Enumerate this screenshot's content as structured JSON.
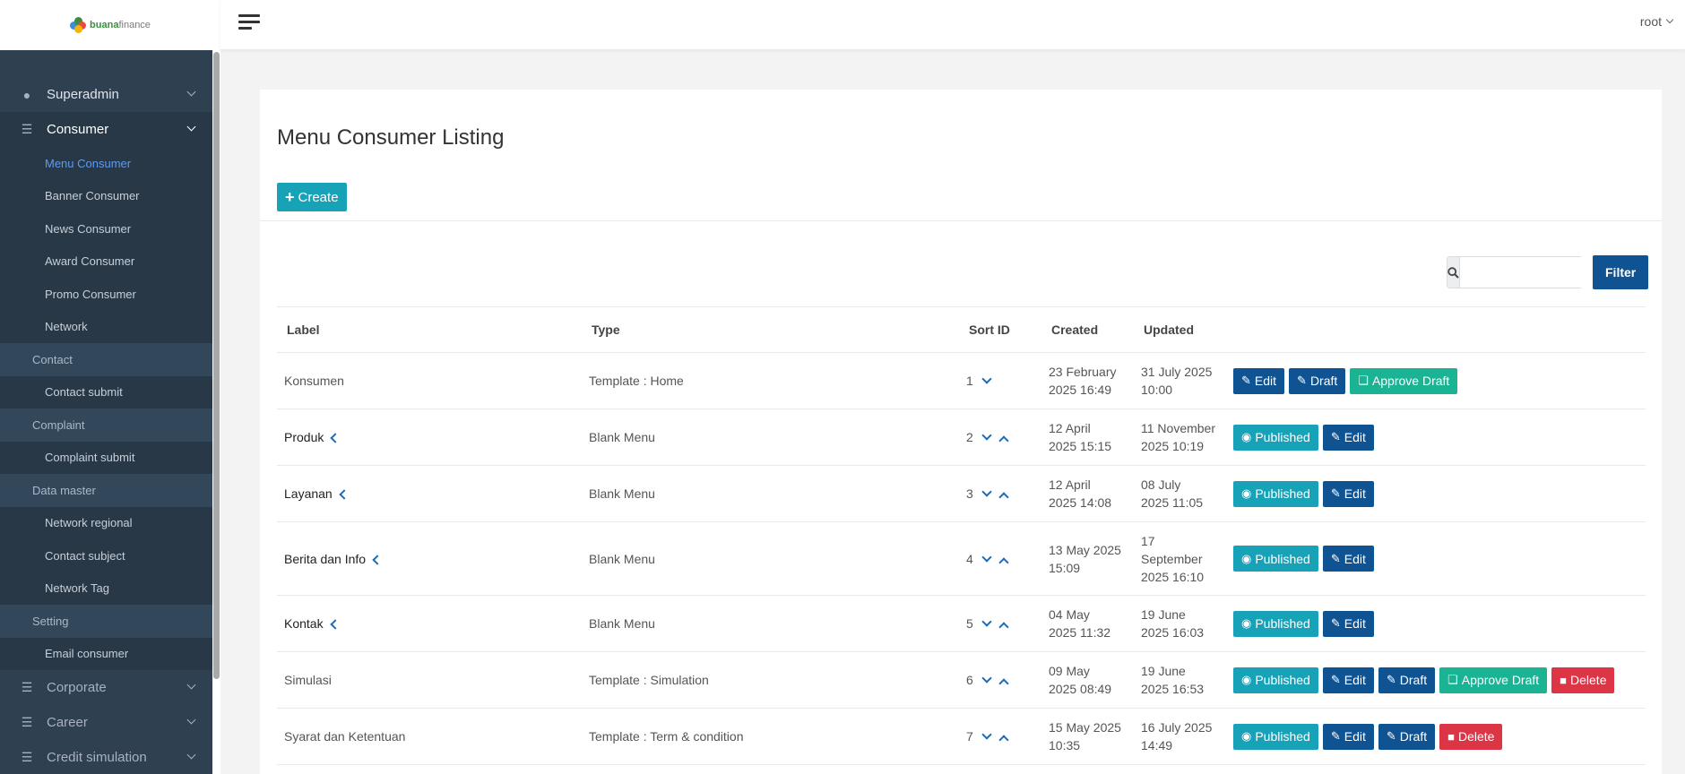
{
  "brand": {
    "part1": "buana",
    "part2": "finance",
    "colors": [
      "#3a8f3f",
      "#e84c3d",
      "#3d8bd9",
      "#f4b400"
    ]
  },
  "user": {
    "name": "root"
  },
  "sidebar": {
    "items": [
      {
        "label": "Superadmin",
        "icon": "user-icon"
      },
      {
        "label": "Consumer",
        "icon": "list-icon"
      }
    ],
    "consumer_sub": [
      "Menu Consumer",
      "Banner Consumer",
      "News Consumer",
      "Award Consumer",
      "Promo Consumer",
      "Network"
    ],
    "groups": [
      {
        "label": "Contact",
        "children": [
          "Contact submit"
        ]
      },
      {
        "label": "Complaint",
        "children": [
          "Complaint submit"
        ]
      },
      {
        "label": "Data master",
        "children": [
          "Network regional",
          "Contact subject",
          "Network Tag"
        ]
      },
      {
        "label": "Setting",
        "children": [
          "Email consumer"
        ]
      }
    ],
    "bottom_items": [
      {
        "label": "Corporate",
        "icon": "list-icon"
      },
      {
        "label": "Career",
        "icon": "list-icon"
      },
      {
        "label": "Credit simulation",
        "icon": "list-icon"
      }
    ]
  },
  "page": {
    "title": "Menu Consumer Listing",
    "create_label": "Create",
    "search_placeholder": "",
    "filter_label": "Filter"
  },
  "table": {
    "headers": [
      "Label",
      "Type",
      "Sort ID",
      "Created",
      "Updated"
    ],
    "rows": [
      {
        "label": "Konsumen",
        "type": "Template : Home",
        "sort": "1",
        "created": [
          "23 February",
          "2025 16:49"
        ],
        "updated": [
          "31 July 2025",
          "10:00"
        ]
      },
      {
        "label": "Produk",
        "type": "Blank Menu",
        "sort": "2",
        "created": [
          "12 April",
          "2025 15:15"
        ],
        "updated": [
          "11 November",
          "2025 10:19"
        ]
      },
      {
        "label": "Layanan",
        "type": "Blank Menu",
        "sort": "3",
        "created": [
          "12 April",
          "2025 14:08"
        ],
        "updated": [
          "08 July",
          "2025 11:05"
        ]
      },
      {
        "label": "Berita dan Info",
        "type": "Blank Menu",
        "sort": "4",
        "created": [
          "13 May 2025",
          "15:09"
        ],
        "updated": [
          "17",
          "September",
          "2025 16:10"
        ]
      },
      {
        "label": "Kontak",
        "type": "Blank Menu",
        "sort": "5",
        "created": [
          "04 May",
          "2025 11:32"
        ],
        "updated": [
          "19 June",
          "2025 16:03"
        ]
      },
      {
        "label": "Simulasi",
        "type": "Template : Simulation",
        "sort": "6",
        "created": [
          "09 May",
          "2025 08:49"
        ],
        "updated": [
          "19 June",
          "2025 16:53"
        ]
      },
      {
        "label": "Syarat dan Ketentuan",
        "type": "Template : Term & condition",
        "sort": "7",
        "created": [
          "15 May 2025",
          "10:35"
        ],
        "updated": [
          "16 July 2025",
          "14:49"
        ]
      }
    ],
    "actions": {
      "edit": "Edit",
      "draft": "Draft",
      "approve": "Approve Draft",
      "published": "Published",
      "delete": "Delete"
    }
  }
}
